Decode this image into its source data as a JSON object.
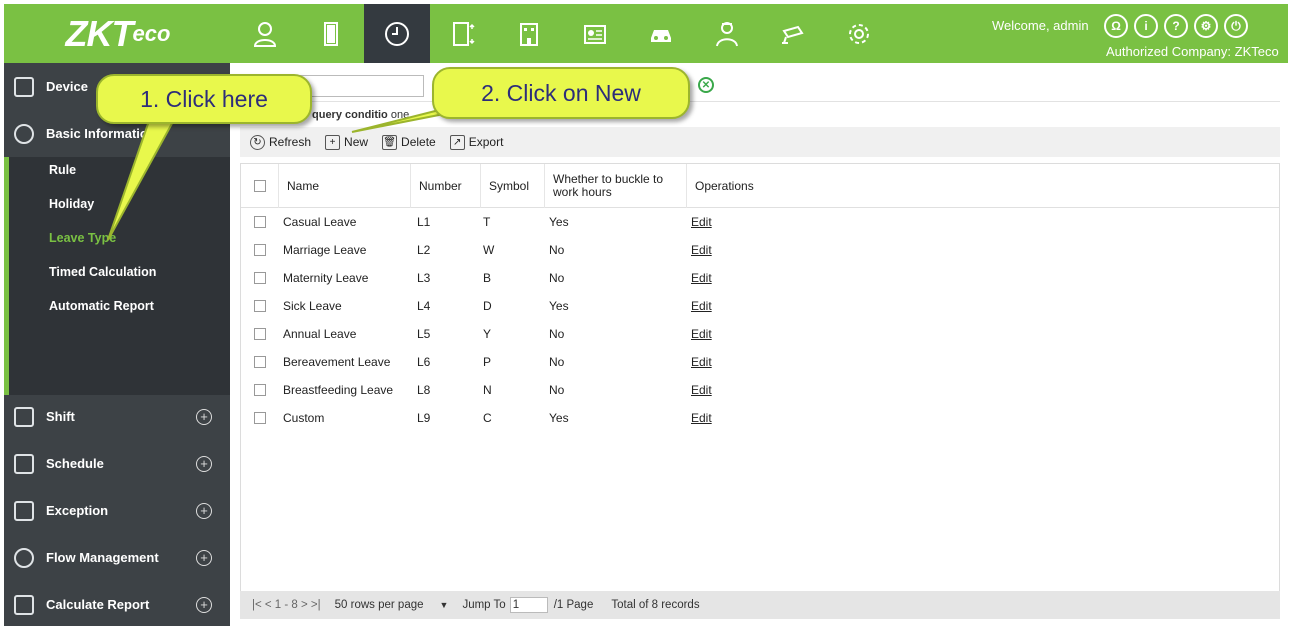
{
  "header": {
    "logo_main": "ZKT",
    "logo_tail": "eco",
    "welcome": "Welcome, admin",
    "company": "Authorized Company: ZKTeco",
    "modules": [
      "personnel-icon",
      "door-icon",
      "attendance-clock-icon",
      "elevator-icon",
      "hotel-icon",
      "visitor-icon",
      "parking-icon",
      "patrol-icon",
      "video-icon",
      "system-settings-icon"
    ],
    "top_icons": [
      "Ω",
      "i",
      "?",
      "⚙",
      "⏻"
    ]
  },
  "sidebar": {
    "device": "Device",
    "basic_information": "Basic Information",
    "sub_items": [
      "Rule",
      "Holiday",
      "Leave Type",
      "Timed Calculation",
      "Automatic Report"
    ],
    "active": "Leave Type",
    "bottom_items": [
      "Shift",
      "Schedule",
      "Exception",
      "Flow Management",
      "Calculate Report"
    ]
  },
  "query": {
    "label": "query conditio",
    "value": "one"
  },
  "toolbar": {
    "refresh": "Refresh",
    "new": "New",
    "delete": "Delete",
    "export": "Export"
  },
  "table": {
    "headers": [
      "Name",
      "Number",
      "Symbol",
      "Whether to buckle to work hours",
      "Operations"
    ],
    "rows": [
      {
        "name": "Casual Leave",
        "number": "L1",
        "symbol": "T",
        "buckle": "Yes",
        "op": "Edit"
      },
      {
        "name": "Marriage Leave",
        "number": "L2",
        "symbol": "W",
        "buckle": "No",
        "op": "Edit"
      },
      {
        "name": "Maternity Leave",
        "number": "L3",
        "symbol": "B",
        "buckle": "No",
        "op": "Edit"
      },
      {
        "name": "Sick Leave",
        "number": "L4",
        "symbol": "D",
        "buckle": "Yes",
        "op": "Edit"
      },
      {
        "name": "Annual Leave",
        "number": "L5",
        "symbol": "Y",
        "buckle": "No",
        "op": "Edit"
      },
      {
        "name": "Bereavement Leave",
        "number": "L6",
        "symbol": "P",
        "buckle": "No",
        "op": "Edit"
      },
      {
        "name": "Breastfeeding Leave",
        "number": "L8",
        "symbol": "N",
        "buckle": "No",
        "op": "Edit"
      },
      {
        "name": "Custom",
        "number": "L9",
        "symbol": "C",
        "buckle": "Yes",
        "op": "Edit"
      }
    ]
  },
  "pager": {
    "nav": "|<  <  1 - 8  >  >|",
    "rows_per_page": "50 rows per page",
    "jump_to": "Jump To",
    "jump_value": "1",
    "pages": "/1 Page",
    "total": "Total of 8 records"
  },
  "callouts": {
    "first": "1. Click here",
    "second": "2. Click on New"
  },
  "colors": {
    "brand_green": "#7ac143",
    "sidebar_dark": "#3d4246",
    "callout_yellow": "#e8f84c"
  }
}
